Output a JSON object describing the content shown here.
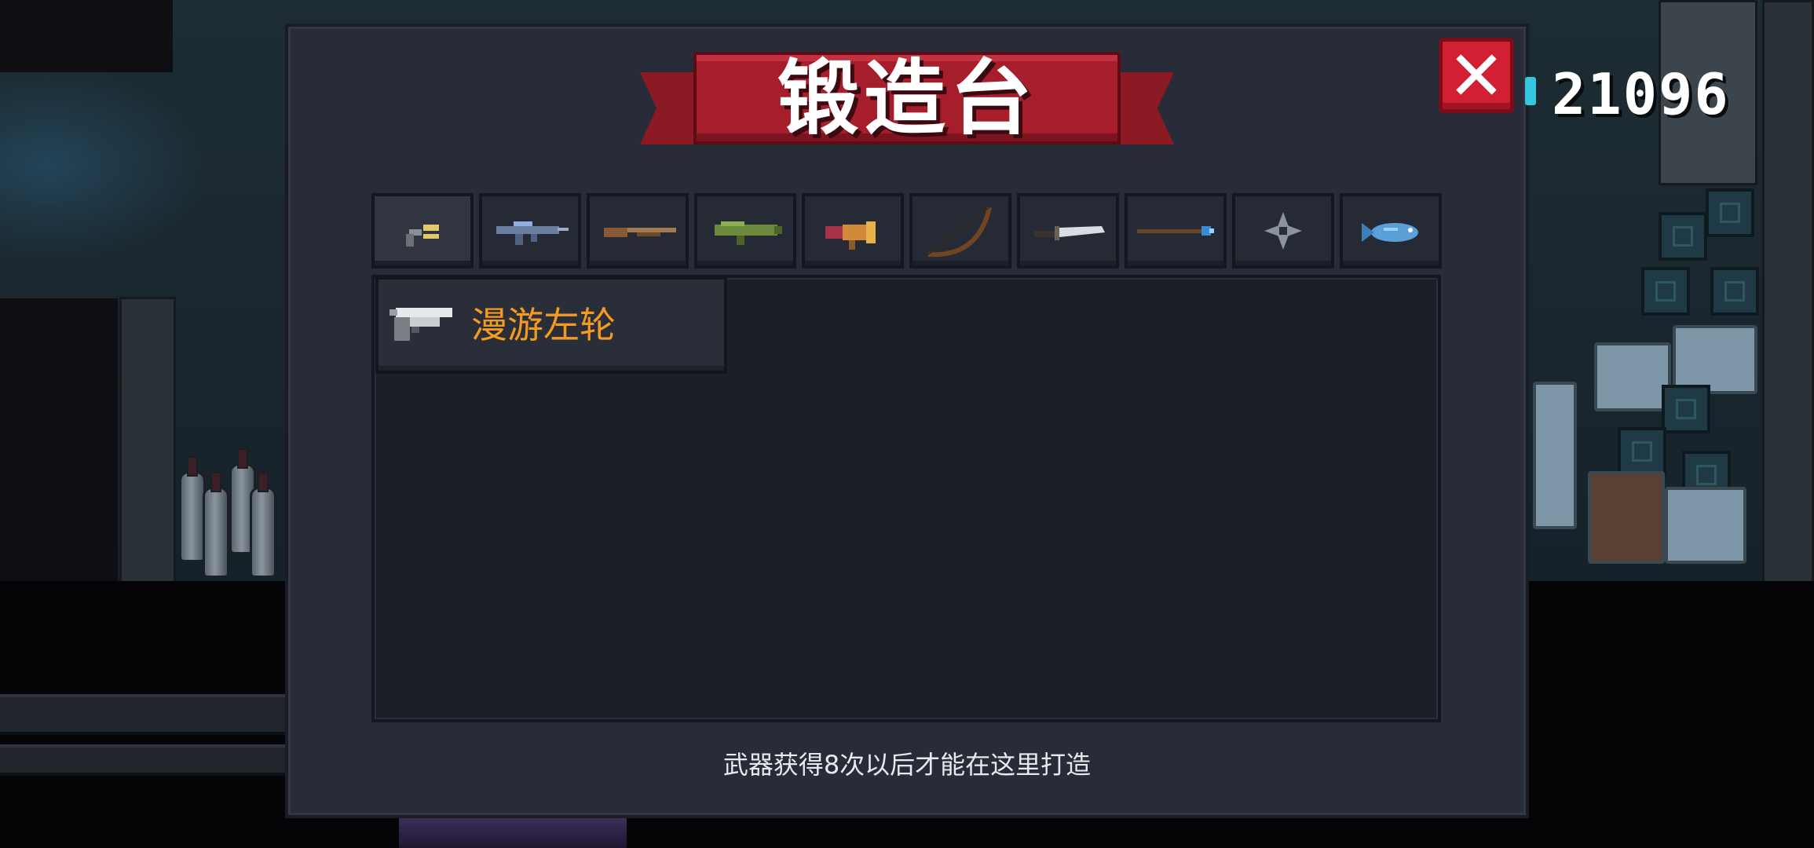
{
  "forge": {
    "title": "锻造台",
    "close_label": "✕",
    "hint": "武器获得8次以后才能在这里打造"
  },
  "currency": {
    "amount": "21096",
    "icon": "gem-icon"
  },
  "category_tabs": [
    {
      "name": "pistol",
      "icon": "pistol-icon",
      "active": true
    },
    {
      "name": "rifle",
      "icon": "assault-rifle-icon",
      "active": false
    },
    {
      "name": "shotgun",
      "icon": "shotgun-icon",
      "active": false
    },
    {
      "name": "launcher",
      "icon": "rocket-launcher-icon",
      "active": false
    },
    {
      "name": "special",
      "icon": "flare-gun-icon",
      "active": false
    },
    {
      "name": "bow",
      "icon": "bow-icon",
      "active": false
    },
    {
      "name": "blade",
      "icon": "sword-icon",
      "active": false
    },
    {
      "name": "staff",
      "icon": "staff-icon",
      "active": false
    },
    {
      "name": "throwing",
      "icon": "shuriken-icon",
      "active": false
    },
    {
      "name": "other",
      "icon": "fish-icon",
      "active": false
    }
  ],
  "weapons": [
    {
      "name": "漫游左轮",
      "icon": "revolver-icon"
    }
  ],
  "colors": {
    "banner_red": "#a61e2c",
    "close_red": "#d21f31",
    "weapon_name": "#f59a20",
    "panel_bg": "#282c38"
  }
}
